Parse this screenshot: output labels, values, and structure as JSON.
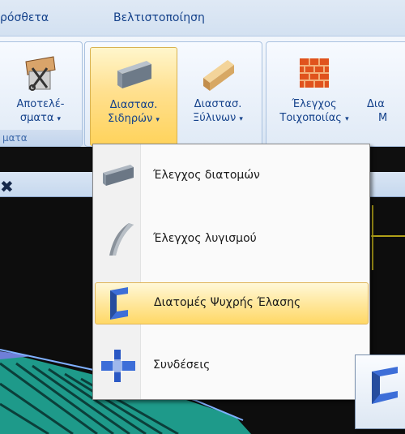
{
  "tabs": {
    "additions": "ρόσθετα",
    "optimization": "Βελτιστοποίηση"
  },
  "ribbon": {
    "results": {
      "line1": "Αποτελέ-",
      "line2": "σματα"
    },
    "steel": {
      "line1": "Διαστασ.",
      "line2": "Σιδηρών"
    },
    "timber": {
      "line1": "Διαστασ.",
      "line2": "Ξύλινων"
    },
    "masonry": {
      "line1": "Έλεγχος",
      "line2": "Τοιχοποιίας"
    },
    "partial": {
      "line1": "Δια",
      "line2": "Μ"
    },
    "group_caption": "ματα"
  },
  "menu": {
    "items": [
      {
        "label": "Έλεγχος διατομών",
        "icon": "steel-beam-icon"
      },
      {
        "label": "Έλεγχος λυγισμού",
        "icon": "buckling-beam-icon"
      },
      {
        "label": "Διατομές Ψυχρής Έλασης",
        "icon": "cold-formed-section-icon"
      },
      {
        "label": "Συνδέσεις",
        "icon": "connection-icon"
      }
    ]
  },
  "colors": {
    "accent_hover": "#ffd866",
    "ribbon_text": "#15428b",
    "canvas": "#0d0d0d"
  }
}
